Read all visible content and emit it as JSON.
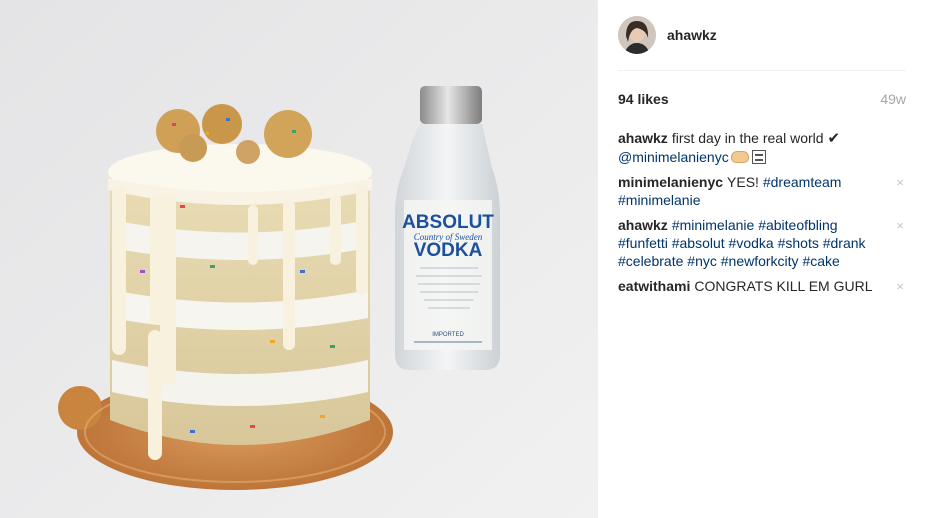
{
  "post": {
    "username": "ahawkz",
    "likes": "94 likes",
    "age": "49w",
    "comments": [
      {
        "user": "ahawkz",
        "segments": [
          {
            "type": "text",
            "value": "first day in the real world "
          },
          {
            "type": "glyph",
            "value": "✔"
          },
          {
            "type": "break"
          },
          {
            "type": "tag",
            "value": "@minimelanienyc"
          },
          {
            "type": "emoji",
            "value": "fist-bump-icon"
          },
          {
            "type": "emoji",
            "value": "unknown-glyph-icon"
          }
        ],
        "closable": false
      },
      {
        "user": "minimelanienyc",
        "segments": [
          {
            "type": "text",
            "value": "YES! "
          },
          {
            "type": "tag",
            "value": "#dreamteam"
          },
          {
            "type": "text",
            "value": " "
          },
          {
            "type": "tag",
            "value": "#minimelanie"
          }
        ],
        "closable": true
      },
      {
        "user": "ahawkz",
        "segments": [
          {
            "type": "tag",
            "value": "#minimelanie"
          },
          {
            "type": "text",
            "value": " "
          },
          {
            "type": "tag",
            "value": "#abiteofbling"
          },
          {
            "type": "text",
            "value": " "
          },
          {
            "type": "tag",
            "value": "#funfetti"
          },
          {
            "type": "text",
            "value": " "
          },
          {
            "type": "tag",
            "value": "#absolut"
          },
          {
            "type": "text",
            "value": " "
          },
          {
            "type": "tag",
            "value": "#vodka"
          },
          {
            "type": "text",
            "value": " "
          },
          {
            "type": "tag",
            "value": "#shots"
          },
          {
            "type": "text",
            "value": " "
          },
          {
            "type": "tag",
            "value": "#drank"
          },
          {
            "type": "text",
            "value": " "
          },
          {
            "type": "tag",
            "value": "#celebrate"
          },
          {
            "type": "text",
            "value": " "
          },
          {
            "type": "tag",
            "value": "#nyc"
          },
          {
            "type": "text",
            "value": " "
          },
          {
            "type": "tag",
            "value": "#newforkcity"
          },
          {
            "type": "text",
            "value": " "
          },
          {
            "type": "tag",
            "value": "#cake"
          }
        ],
        "closable": true
      },
      {
        "user": "eatwithami",
        "segments": [
          {
            "type": "text",
            "value": "CONGRATS KILL EM GURL"
          }
        ],
        "closable": true
      }
    ],
    "close_glyph": "×"
  },
  "photo": {
    "bottle_brand": "ABSOLUT",
    "bottle_sub": "Country of Sweden",
    "bottle_product": "VODKA",
    "bottle_imported": "IMPORTED"
  },
  "colors": {
    "link": "#003569",
    "muted": "#a5a7aa",
    "close": "#c7c7c7"
  }
}
